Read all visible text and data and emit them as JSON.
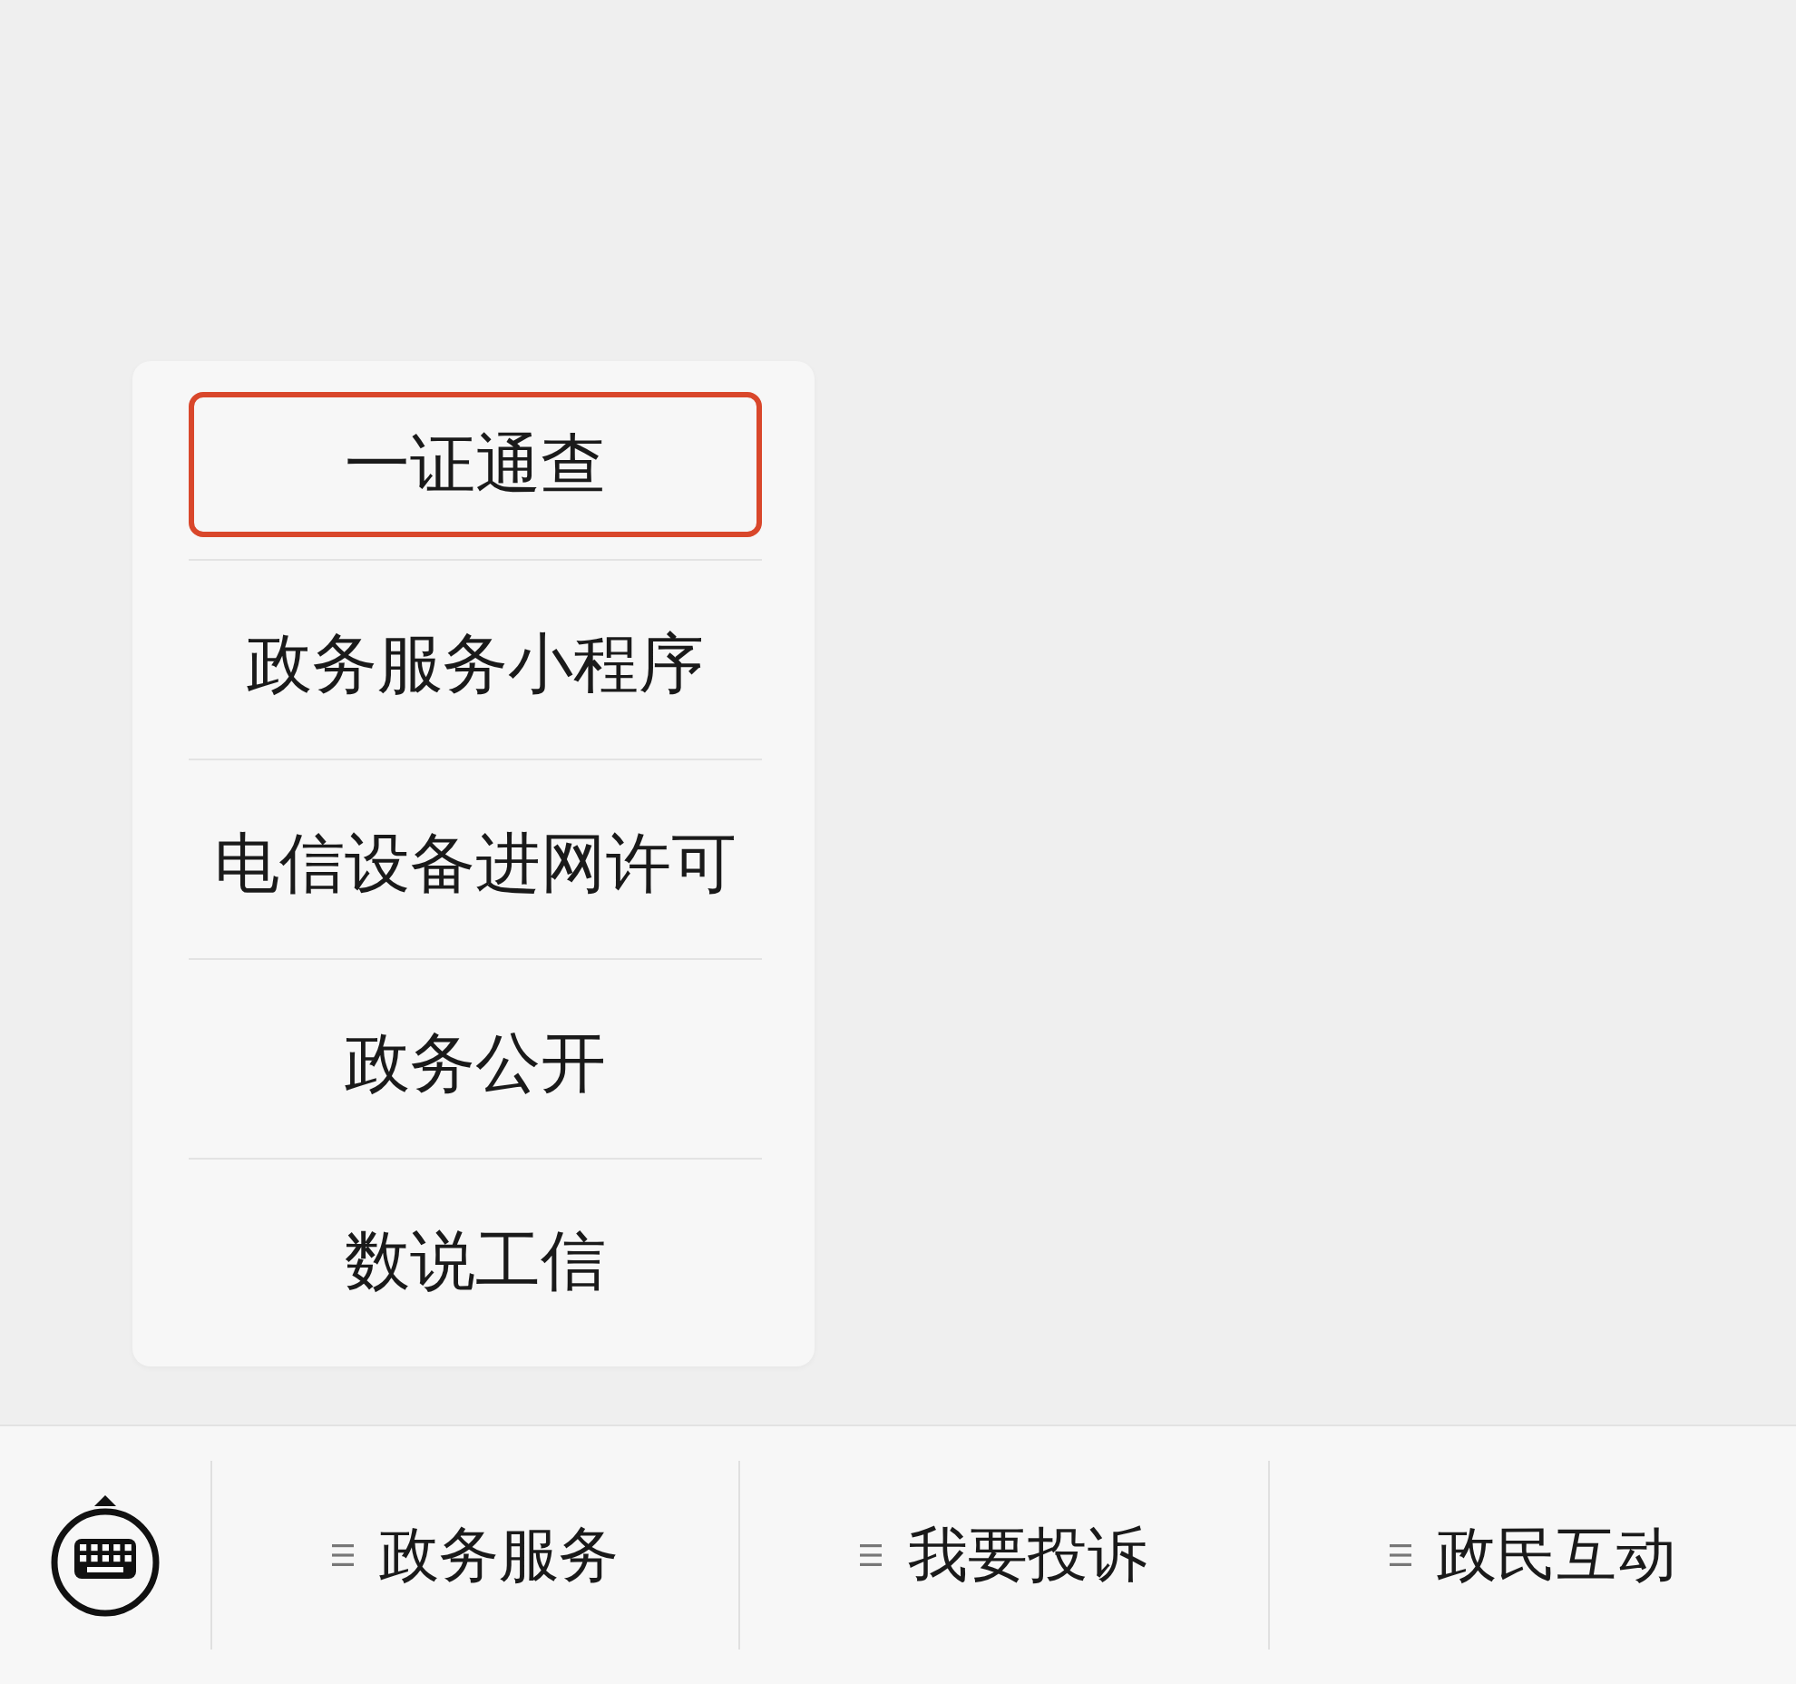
{
  "popup_menu": {
    "items": [
      {
        "label": "一证通查",
        "highlighted": true
      },
      {
        "label": "政务服务小程序",
        "highlighted": false
      },
      {
        "label": "电信设备进网许可",
        "highlighted": false
      },
      {
        "label": "政务公开",
        "highlighted": false
      },
      {
        "label": "数说工信",
        "highlighted": false
      }
    ]
  },
  "menu_bar": {
    "items": [
      {
        "label": "政务服务"
      },
      {
        "label": "我要投诉"
      },
      {
        "label": "政民互动"
      }
    ]
  }
}
